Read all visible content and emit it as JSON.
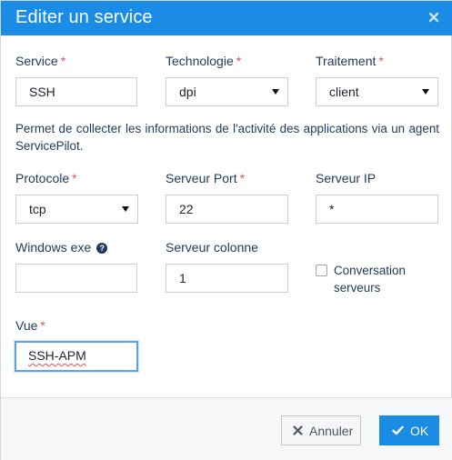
{
  "dialog": {
    "title": "Editer un service",
    "close_icon": "close-icon"
  },
  "form": {
    "service": {
      "label": "Service",
      "required_mark": "*",
      "value": "SSH"
    },
    "technologie": {
      "label": "Technologie",
      "required_mark": "*",
      "value": "dpi"
    },
    "traitement": {
      "label": "Traitement",
      "required_mark": "*",
      "value": "client"
    },
    "description": "Permet de collecter les informations de l'activité des applications via un agent ServicePilot.",
    "protocole": {
      "label": "Protocole",
      "required_mark": "*",
      "value": "tcp"
    },
    "serveur_port": {
      "label": "Serveur Port",
      "required_mark": "*",
      "value": "22"
    },
    "serveur_ip": {
      "label": "Serveur IP",
      "value": "*"
    },
    "windows_exe": {
      "label": "Windows exe",
      "value": "",
      "help_icon": "question-circle-icon"
    },
    "serveur_colonne": {
      "label": "Serveur colonne",
      "value": "1"
    },
    "conversation": {
      "label": "Conversation serveurs",
      "checked": false
    },
    "vue": {
      "label": "Vue",
      "required_mark": "*",
      "value": "SSH-APM"
    }
  },
  "footer": {
    "cancel_label": "Annuler",
    "ok_label": "OK"
  },
  "colors": {
    "accent": "#1a8ce6",
    "required": "#e8534f",
    "text": "#1d3a5a"
  }
}
